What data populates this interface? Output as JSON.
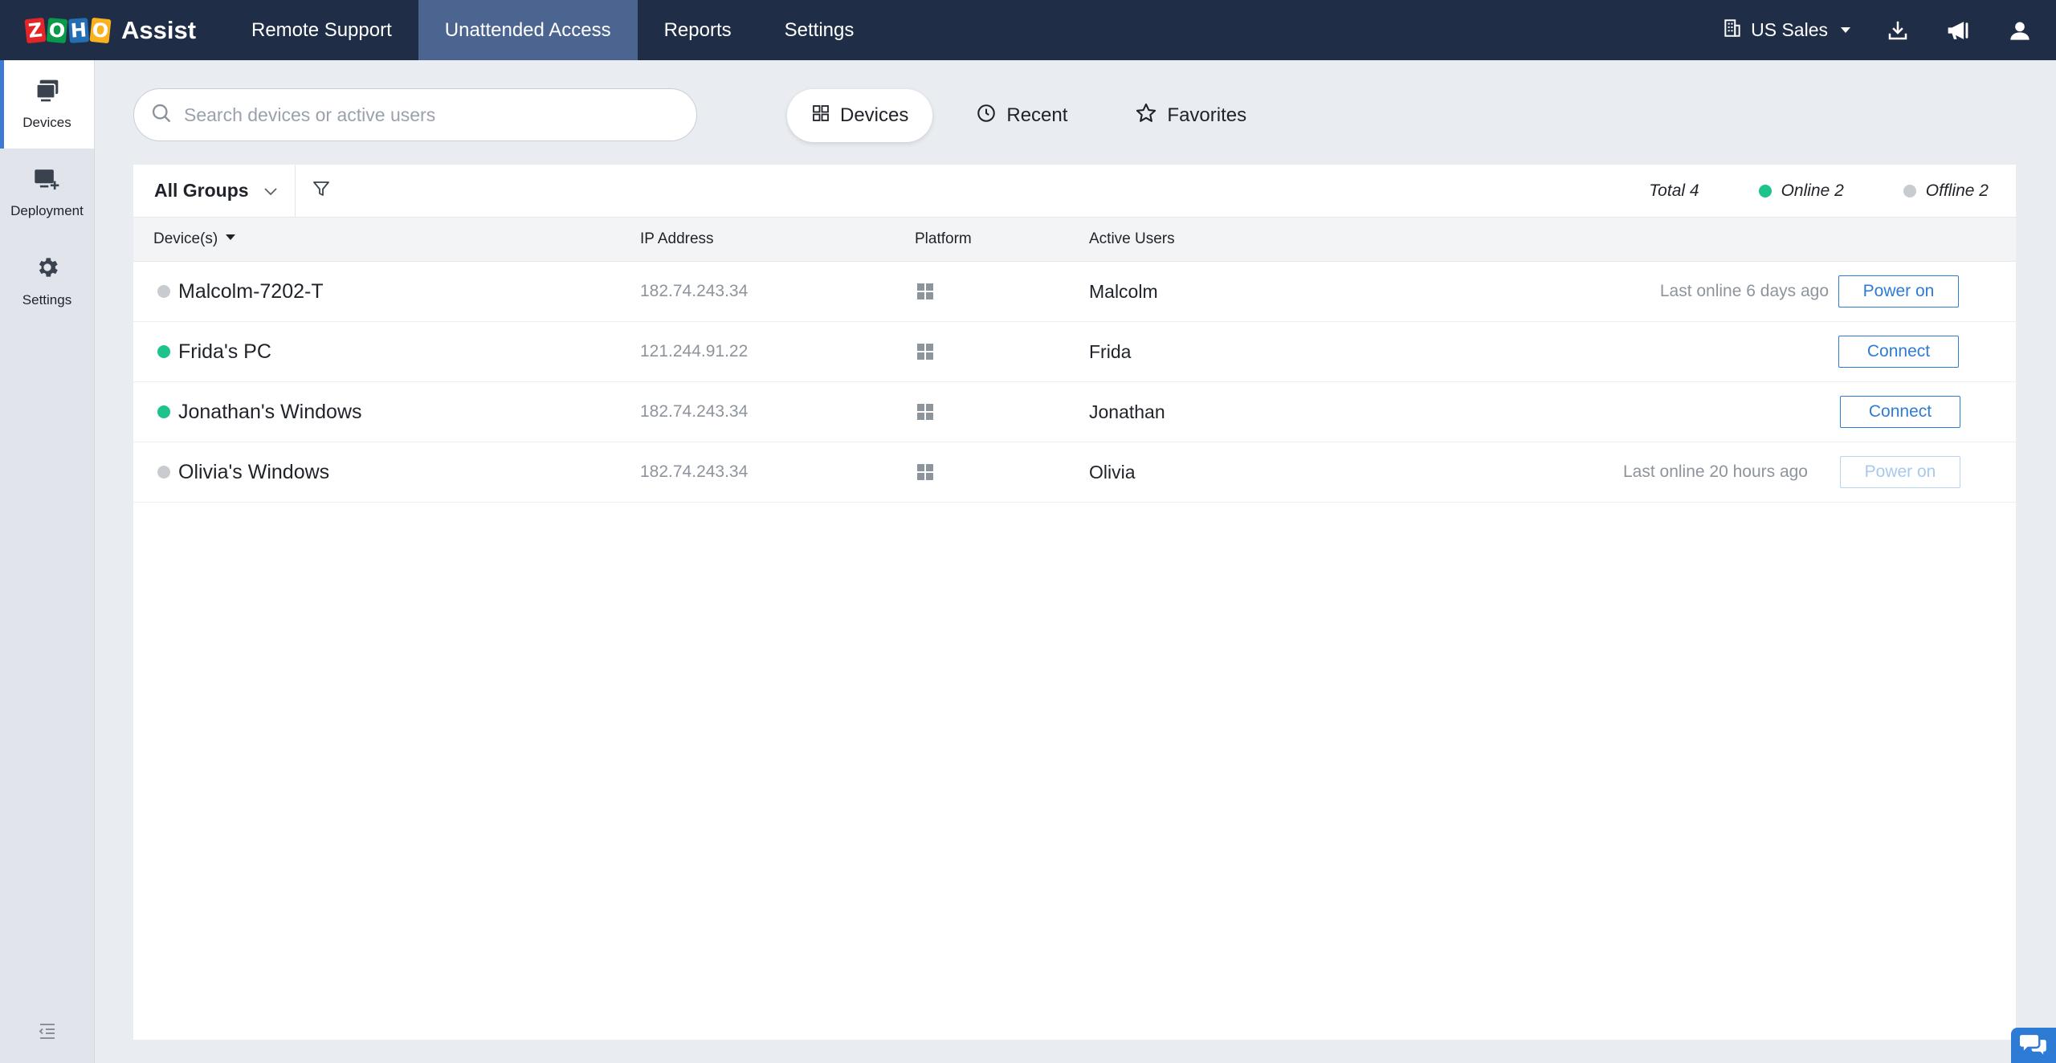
{
  "brand": {
    "logo_letters": [
      "Z",
      "O",
      "H",
      "O"
    ],
    "logo_colors": [
      "#e42527",
      "#089949",
      "#226db4",
      "#f9b21d"
    ],
    "product": "Assist"
  },
  "nav": {
    "items": [
      {
        "label": "Remote Support"
      },
      {
        "label": "Unattended Access",
        "active": true
      },
      {
        "label": "Reports"
      },
      {
        "label": "Settings"
      }
    ]
  },
  "topright": {
    "org": "US Sales",
    "icons": [
      "download-icon",
      "announcement-icon",
      "user-icon"
    ]
  },
  "sidebar": {
    "items": [
      {
        "label": "Devices",
        "icon": "devices-icon",
        "active": true
      },
      {
        "label": "Deployment",
        "icon": "deployment-icon"
      },
      {
        "label": "Settings",
        "icon": "gear-icon"
      }
    ]
  },
  "search": {
    "placeholder": "Search devices or active users"
  },
  "tabs": [
    {
      "label": "Devices",
      "icon": "grid-icon",
      "active": true
    },
    {
      "label": "Recent",
      "icon": "clock-icon"
    },
    {
      "label": "Favorites",
      "icon": "star-icon"
    }
  ],
  "filter": {
    "group": "All Groups",
    "total": "Total 4",
    "online": "Online 2",
    "offline": "Offline 2"
  },
  "table": {
    "headers": {
      "device": "Device(s)",
      "ip": "IP Address",
      "platform": "Platform",
      "users": "Active Users"
    },
    "rows": [
      {
        "name": "Malcolm-7202-T",
        "status": "offline",
        "ip": "182.74.243.34",
        "platform": "windows-icon",
        "user": "Malcolm",
        "last_online": "Last online 6 days ago",
        "action": "Power on",
        "action_enabled": true
      },
      {
        "name": "Frida's PC",
        "status": "online",
        "ip": "121.244.91.22",
        "platform": "windows-icon",
        "user": "Frida",
        "last_online": "",
        "action": "Connect",
        "action_enabled": true
      },
      {
        "name": "Jonathan's Windows",
        "status": "online",
        "ip": "182.74.243.34",
        "platform": "windows-icon",
        "user": "Jonathan",
        "last_online": "",
        "action": "Connect",
        "action_enabled": true
      },
      {
        "name": "Olivia's Windows",
        "status": "offline",
        "ip": "182.74.243.34",
        "platform": "windows-icon",
        "user": "Olivia",
        "last_online": "Last online 20 hours ago",
        "action": "Power on",
        "action_enabled": false
      }
    ]
  },
  "colors": {
    "online": "#1ec28b",
    "offline": "#c8cbd0",
    "accent": "#2e7bd6",
    "topbar": "#1f2d46"
  }
}
